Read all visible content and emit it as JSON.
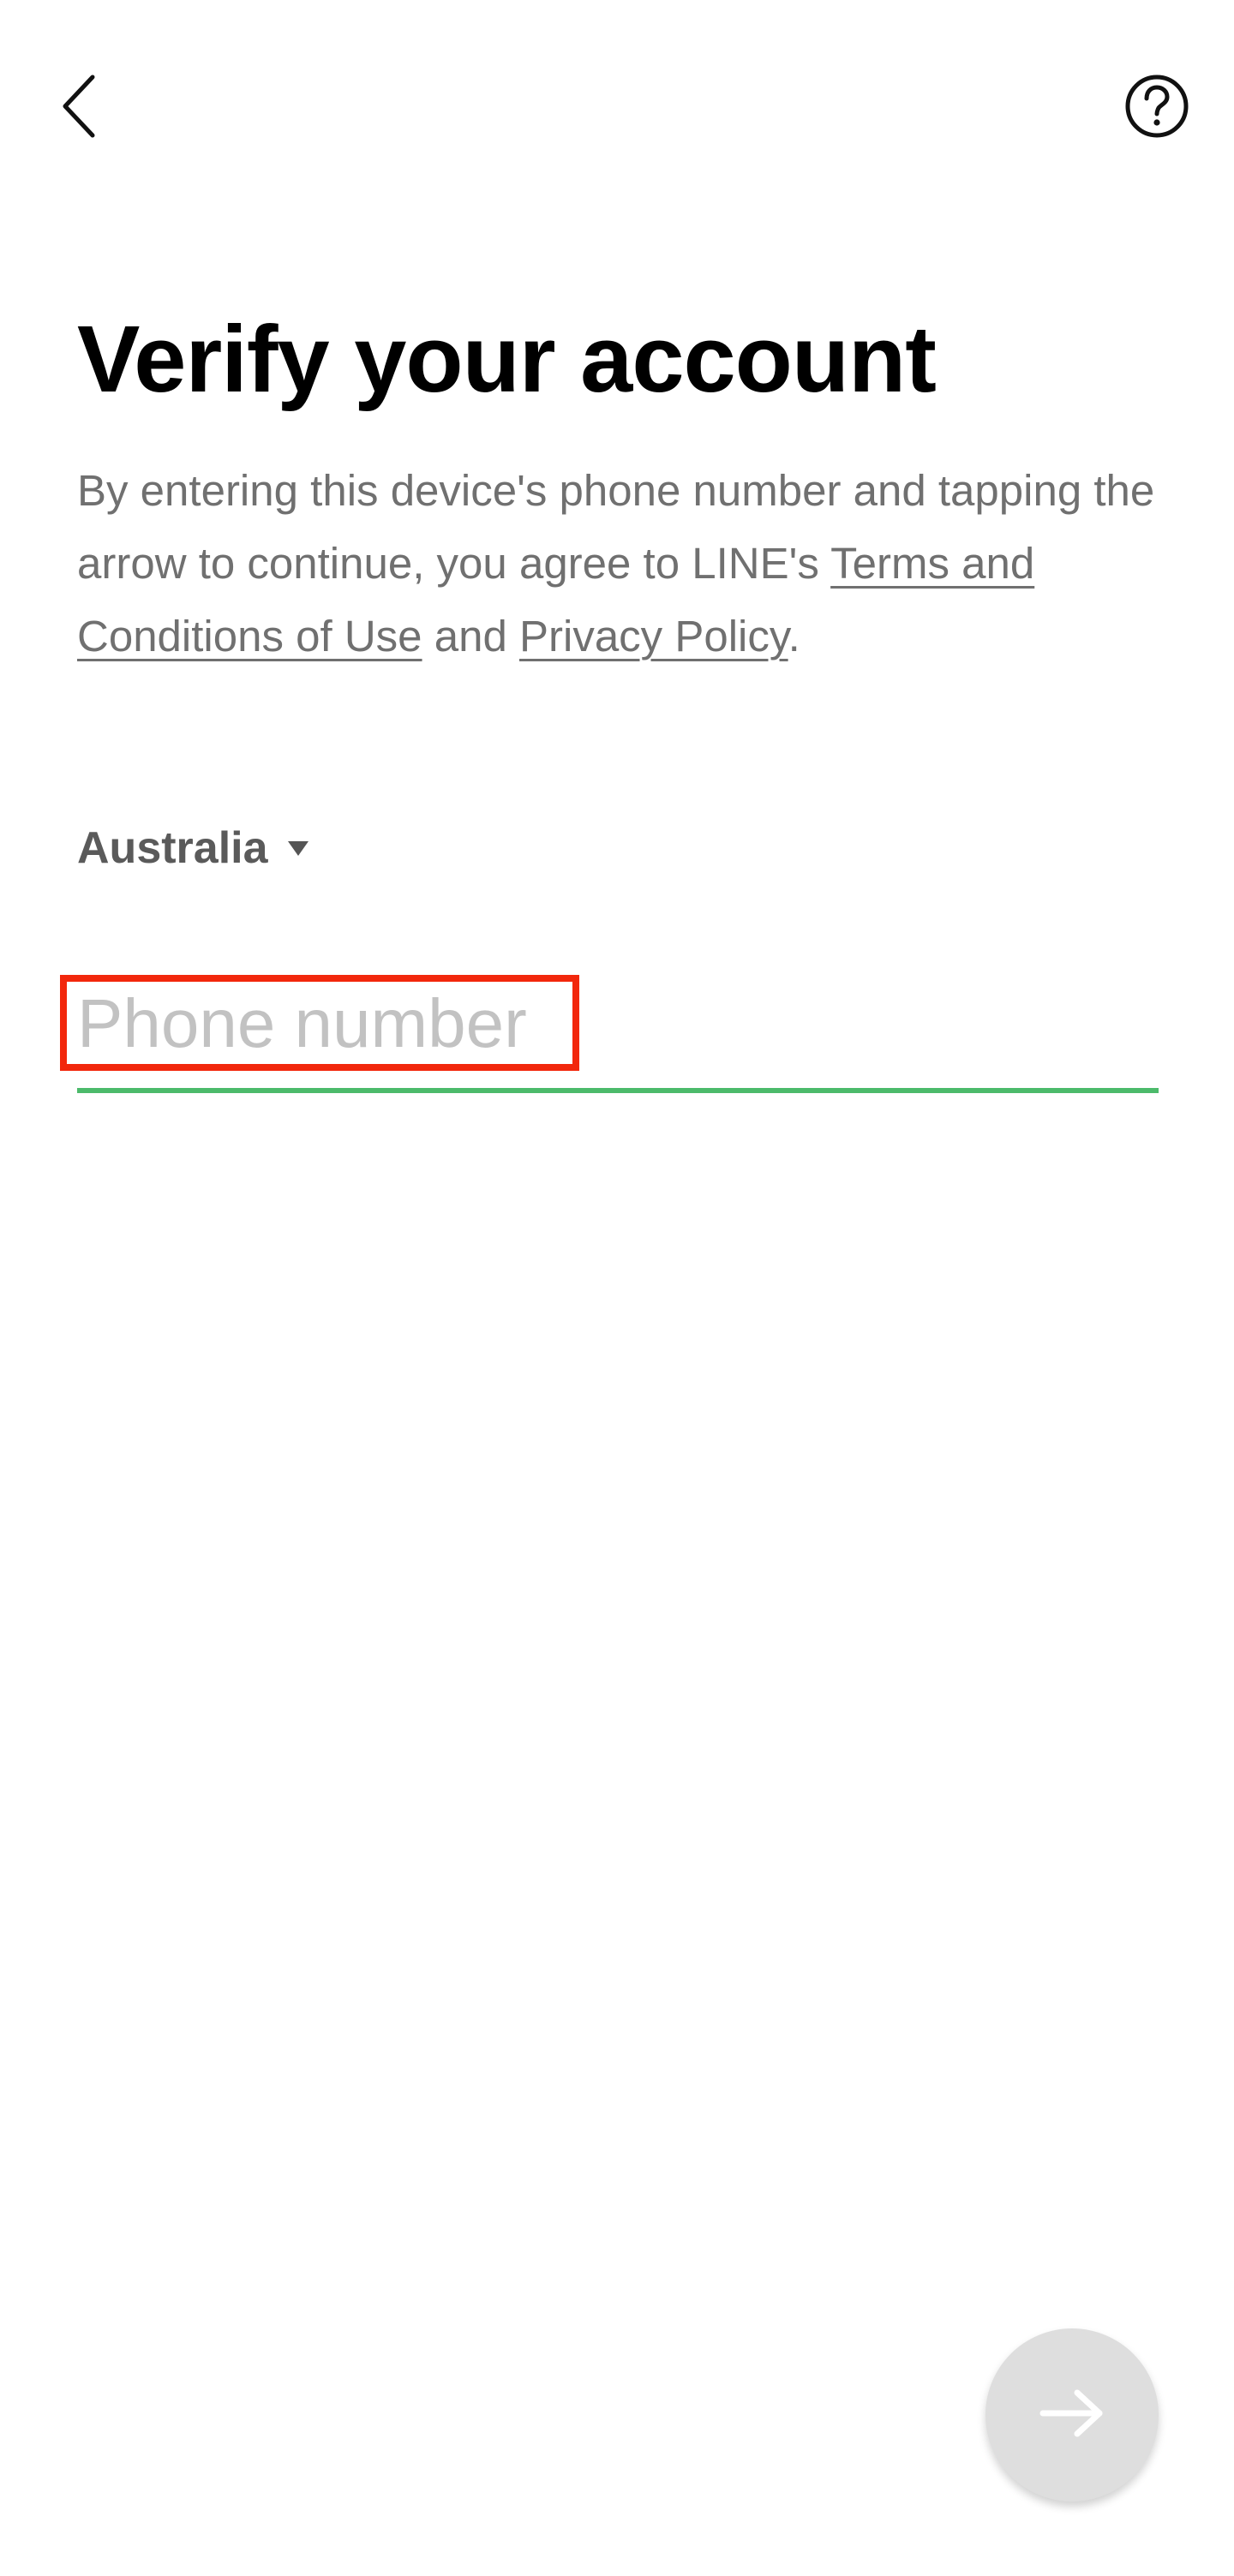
{
  "header": {
    "back_icon": "chevron-left-icon",
    "help_icon": "question-circle-icon"
  },
  "main": {
    "title": "Verify your account",
    "description": {
      "text_before": "By entering this device's phone number and tapping the arrow to continue, you agree to LINE's ",
      "terms_link": "Terms and Conditions of Use",
      "text_middle": " and ",
      "privacy_link": "Privacy Policy",
      "text_after": "."
    },
    "country": {
      "selected": "Australia",
      "caret_icon": "caret-down-icon"
    },
    "phone": {
      "value": "",
      "placeholder": "Phone number"
    }
  },
  "footer": {
    "next_icon": "arrow-right-icon"
  },
  "colors": {
    "accent_underline": "#4cba6b",
    "highlight_box": "#f2270c",
    "next_button_bg": "#dedede"
  }
}
